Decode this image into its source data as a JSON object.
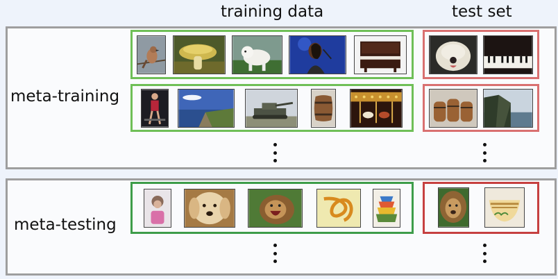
{
  "headers": {
    "training_data": "training data",
    "test_set": "test set"
  },
  "rows": {
    "meta_training": "meta-training",
    "meta_testing": "meta-testing"
  },
  "thumbnails": {
    "meta_training_row1_train": [
      "bird",
      "mushroom",
      "white dog",
      "singer",
      "piano"
    ],
    "meta_training_row1_test": [
      "shaggy dog",
      "piano keys"
    ],
    "meta_training_row2_train": [
      "gymnast",
      "ocean cliffs",
      "tank",
      "barrel",
      "carousel"
    ],
    "meta_training_row2_test": [
      "barrels",
      "sea cliffs"
    ],
    "meta_testing_train": [
      "girl",
      "golden retriever",
      "lion roaring",
      "knot",
      "bowls"
    ],
    "meta_testing_test": [
      "lion",
      "bowl"
    ]
  },
  "colors": {
    "green": "#6fbf57",
    "dark_green": "#3e9d4a",
    "red": "#d97070",
    "dark_red": "#c64040",
    "panel_border": "#9e9e9e"
  }
}
